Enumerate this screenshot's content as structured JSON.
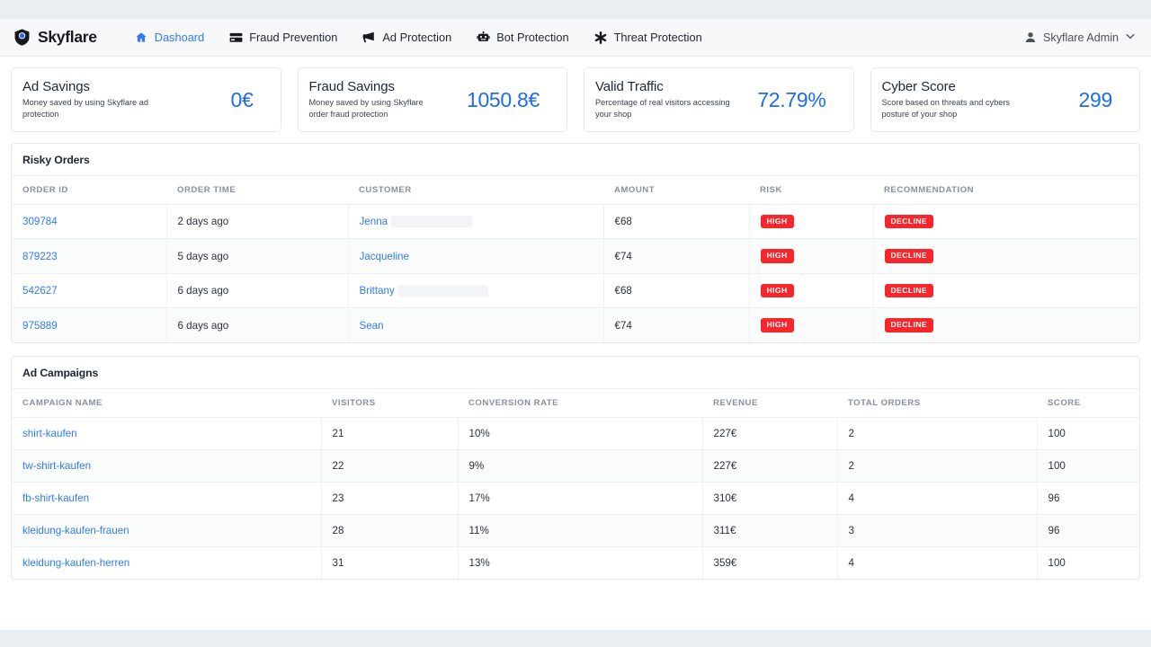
{
  "navbar": {
    "brand": "Skyflare",
    "brand_icon": "shield-logo-icon",
    "links": [
      {
        "label": "Dashoard",
        "icon": "home-icon",
        "active": true
      },
      {
        "label": "Fraud Prevention",
        "icon": "credit-card-icon",
        "active": false
      },
      {
        "label": "Ad Protection",
        "icon": "megaphone-icon",
        "active": false
      },
      {
        "label": "Bot Protection",
        "icon": "robot-icon",
        "active": false
      },
      {
        "label": "Threat Protection",
        "icon": "asterisk-icon",
        "active": false
      }
    ],
    "account": {
      "label": "Skyflare Admin",
      "icon": "user-icon",
      "caret": "⌄"
    }
  },
  "colors": {
    "accent": "#2f7bf6",
    "value": "#1f6bf0",
    "danger": "#f8262b",
    "page_bg": "#e9eef3",
    "navbar_bg": "#f7f8f9"
  },
  "stats": [
    {
      "title": "Ad Savings",
      "desc": "Money saved by using Skyflare ad protection",
      "value": "0€"
    },
    {
      "title": "Fraud Savings",
      "desc": "Money saved by using Skyflare order fraud protection",
      "value": "1050.8€"
    },
    {
      "title": "Valid Traffic",
      "desc": "Percentage of real visitors accessing your shop",
      "value": "72.79%"
    },
    {
      "title": "Cyber Score",
      "desc": "Score based on threats and cybers posture of your shop",
      "value": "299"
    }
  ],
  "risky_orders": {
    "title": "Risky Orders",
    "columns": [
      "ORDER ID",
      "ORDER TIME",
      "CUSTOMER",
      "AMOUNT",
      "RISK",
      "RECOMMENDATION"
    ],
    "rows": [
      {
        "order_id": "309784",
        "order_time": "2 days ago",
        "customer": "Jenna",
        "redacted": 90,
        "amount": "€68",
        "risk": "HIGH",
        "recommendation": "DECLINE"
      },
      {
        "order_id": "879223",
        "order_time": "5 days ago",
        "customer": "Jacqueline",
        "redacted": 0,
        "amount": "€74",
        "risk": "HIGH",
        "recommendation": "DECLINE"
      },
      {
        "order_id": "542627",
        "order_time": "6 days ago",
        "customer": "Brittany",
        "redacted": 100,
        "amount": "€68",
        "risk": "HIGH",
        "recommendation": "DECLINE"
      },
      {
        "order_id": "975889",
        "order_time": "6 days ago",
        "customer": "Sean",
        "redacted": 0,
        "amount": "€74",
        "risk": "HIGH",
        "recommendation": "DECLINE"
      }
    ]
  },
  "ad_campaigns": {
    "title": "Ad Campaigns",
    "columns": [
      "CAMPAIGN NAME",
      "VISITORS",
      "CONVERSION RATE",
      "REVENUE",
      "TOTAL ORDERS",
      "SCORE"
    ],
    "rows": [
      {
        "name": "shirt-kaufen",
        "visitors": "21",
        "conversion_rate": "10%",
        "revenue": "227€",
        "total_orders": "2",
        "score": "100"
      },
      {
        "name": "tw-shirt-kaufen",
        "visitors": "22",
        "conversion_rate": "9%",
        "revenue": "227€",
        "total_orders": "2",
        "score": "100"
      },
      {
        "name": "fb-shirt-kaufen",
        "visitors": "23",
        "conversion_rate": "17%",
        "revenue": "310€",
        "total_orders": "4",
        "score": "96"
      },
      {
        "name": "kleidung-kaufen-frauen",
        "visitors": "28",
        "conversion_rate": "11%",
        "revenue": "311€",
        "total_orders": "3",
        "score": "96"
      },
      {
        "name": "kleidung-kaufen-herren",
        "visitors": "31",
        "conversion_rate": "13%",
        "revenue": "359€",
        "total_orders": "4",
        "score": "100"
      }
    ]
  }
}
